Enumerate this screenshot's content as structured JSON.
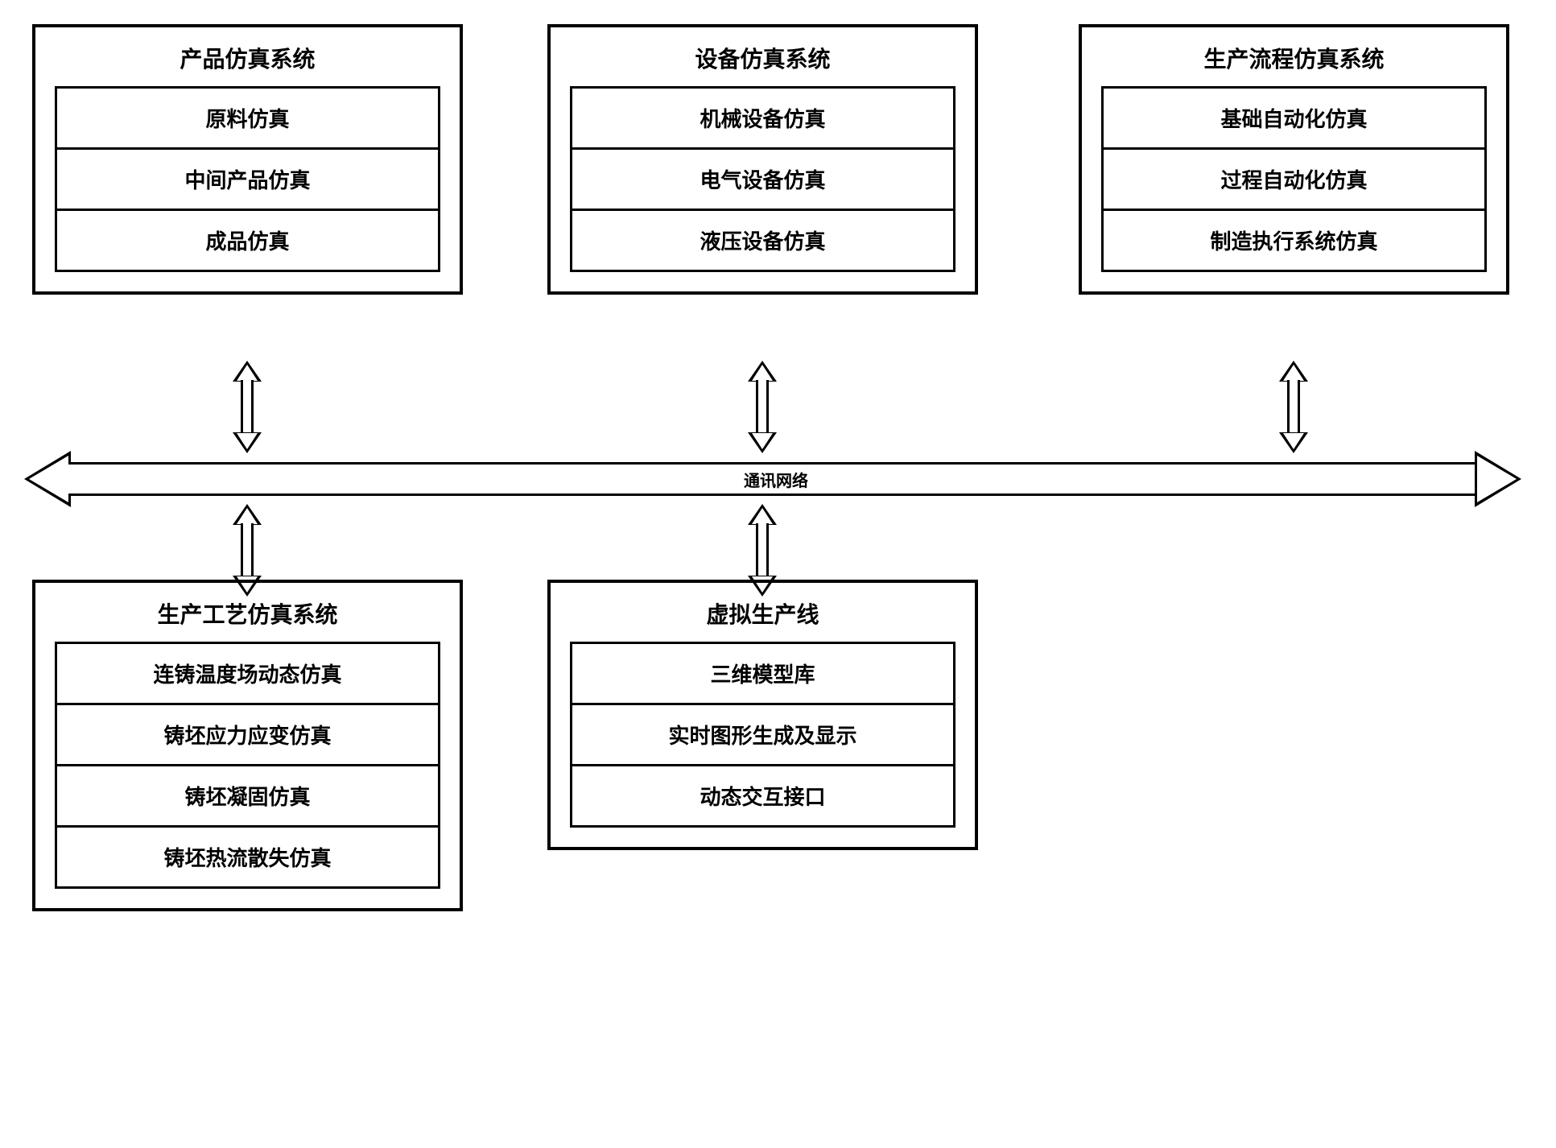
{
  "bus_label": "通讯网络",
  "systems": {
    "product": {
      "title": "产品仿真系统",
      "items": [
        "原料仿真",
        "中间产品仿真",
        "成品仿真"
      ]
    },
    "equipment": {
      "title": "设备仿真系统",
      "items": [
        "机械设备仿真",
        "电气设备仿真",
        "液压设备仿真"
      ]
    },
    "flow": {
      "title": "生产流程仿真系统",
      "items": [
        "基础自动化仿真",
        "过程自动化仿真",
        "制造执行系统仿真"
      ]
    },
    "process": {
      "title": "生产工艺仿真系统",
      "items": [
        "连铸温度场动态仿真",
        "铸坯应力应变仿真",
        "铸坯凝固仿真",
        "铸坯热流散失仿真"
      ]
    },
    "virtual": {
      "title": "虚拟生产线",
      "items": [
        "三维模型库",
        "实时图形生成及显示",
        "动态交互接口"
      ]
    }
  }
}
